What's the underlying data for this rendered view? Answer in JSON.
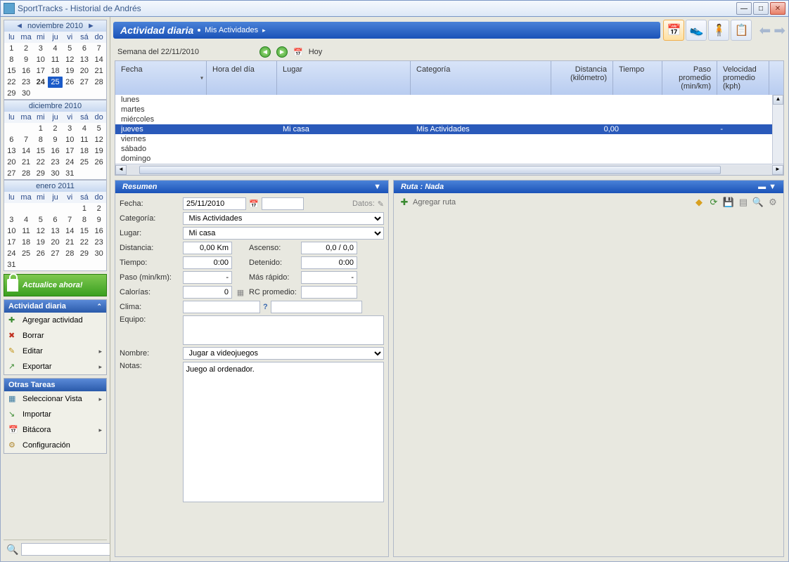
{
  "window": {
    "title": "SportTracks - Historial de Andrés"
  },
  "calendars": [
    {
      "month": "noviembre 2010",
      "lead": 0,
      "days": 30,
      "bold": [
        24
      ],
      "selected": [
        25
      ],
      "hasArrows": true
    },
    {
      "month": "diciembre 2010",
      "lead": 2,
      "days": 31,
      "bold": [],
      "selected": [],
      "hasArrows": false
    },
    {
      "month": "enero 2011",
      "lead": 5,
      "days": 31,
      "bold": [],
      "selected": [],
      "hasArrows": false
    }
  ],
  "dayHeaders": [
    "lu",
    "ma",
    "mi",
    "ju",
    "vi",
    "sá",
    "do"
  ],
  "updateBtn": "Actualice ahora!",
  "navDaily": {
    "title": "Actividad diaria",
    "items": [
      {
        "icon": "plus",
        "color": "#3a8a30",
        "label": "Agregar actividad"
      },
      {
        "icon": "x",
        "color": "#c03020",
        "label": "Borrar"
      },
      {
        "icon": "pencil",
        "color": "#c09010",
        "label": "Editar",
        "sub": true
      },
      {
        "icon": "export",
        "color": "#3a8a30",
        "label": "Exportar",
        "sub": true
      }
    ]
  },
  "navOther": {
    "title": "Otras Tareas",
    "items": [
      {
        "icon": "grid",
        "color": "#3a7aa0",
        "label": "Seleccionar Vista",
        "sub": true
      },
      {
        "icon": "import",
        "color": "#3a8a30",
        "label": "Importar"
      },
      {
        "icon": "cal",
        "color": "#c09010",
        "label": "Bitácora",
        "sub": true
      },
      {
        "icon": "gear",
        "color": "#b08830",
        "label": "Configuración"
      }
    ]
  },
  "header": {
    "title": "Actividad diaria",
    "sub": "Mis Actividades"
  },
  "weekLabel": "Semana del 22/11/2010",
  "todayBtn": "Hoy",
  "gridCols": [
    "Fecha",
    "Hora del día",
    "Lugar",
    "Categoría",
    "Distancia (kilómetro)",
    "Tiempo",
    "Paso promedio (min/km)",
    "Velocidad promedio (kph)"
  ],
  "gridRows": [
    {
      "fecha": "lunes"
    },
    {
      "fecha": "martes"
    },
    {
      "fecha": "miércoles"
    },
    {
      "fecha": "jueves",
      "lugar": "Mi casa",
      "cat": "Mis Actividades",
      "dist": "0,00",
      "paso": "-",
      "sel": true
    },
    {
      "fecha": "viernes"
    },
    {
      "fecha": "sábado"
    },
    {
      "fecha": "domingo"
    }
  ],
  "summary": {
    "title": "Resumen",
    "labels": {
      "fecha": "Fecha:",
      "categoria": "Categoría:",
      "lugar": "Lugar:",
      "distancia": "Distancia:",
      "tiempo": "Tiempo:",
      "paso": "Paso (min/km):",
      "calorias": "Calorías:",
      "clima": "Clima:",
      "equipo": "Equipo:",
      "nombre": "Nombre:",
      "notas": "Notas:",
      "ascenso": "Ascenso:",
      "detenido": "Detenido:",
      "masrapido": "Más rápido:",
      "rcprom": "RC promedio:",
      "datos": "Datos:"
    },
    "values": {
      "fecha": "25/11/2010",
      "categoria": "Mis Actividades",
      "lugar": "Mi casa",
      "distancia": "0,00 Km",
      "tiempo": "0:00",
      "paso": "-",
      "calorias": "0",
      "ascenso": "0,0 / 0,0",
      "detenido": "0:00",
      "masrapido": "-",
      "rcprom": "",
      "nombre": "Jugar a videojuegos",
      "notas": "Juego al ordenador."
    }
  },
  "route": {
    "title": "Ruta : Nada",
    "add": "Agregar ruta"
  }
}
